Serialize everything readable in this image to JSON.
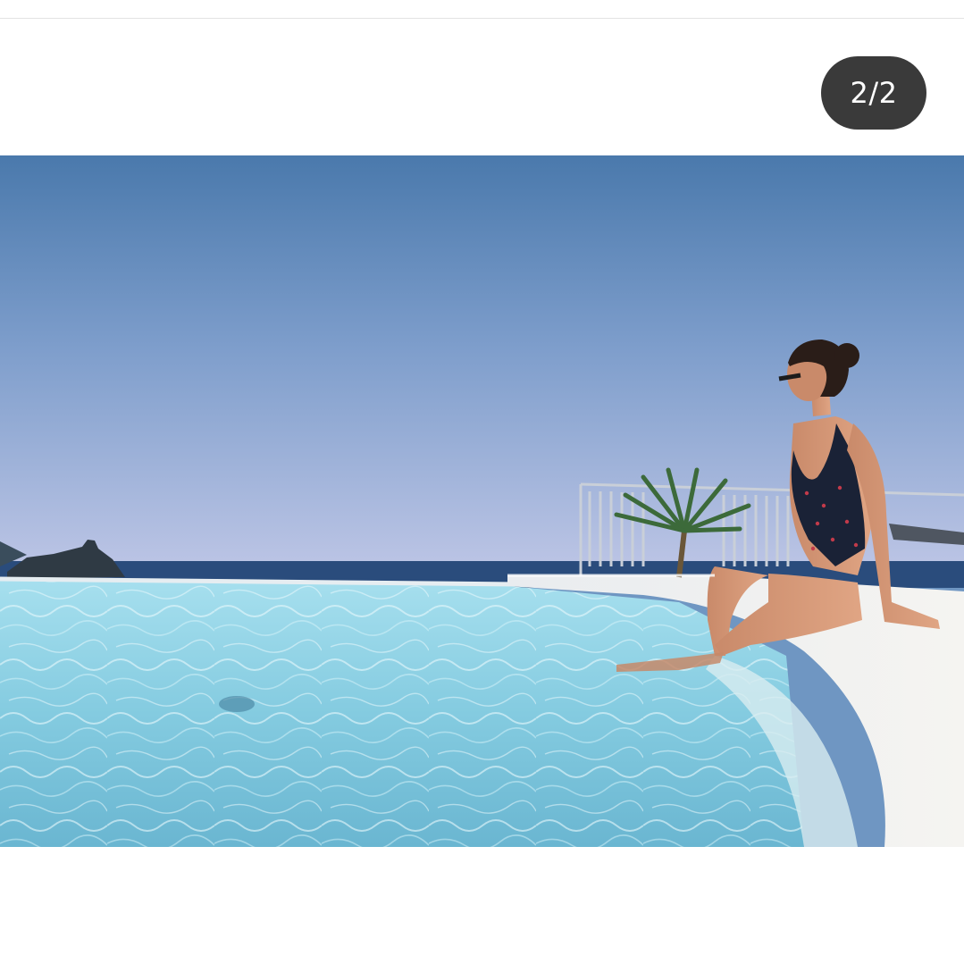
{
  "viewer": {
    "page_counter": "2/2"
  },
  "photo": {
    "subject": "woman-sitting-on-pool-edge",
    "scene": "infinity-pool-overlooking-sea",
    "colors": {
      "sky_top": "#4a79ac",
      "sky_horizon": "#b9c3e3",
      "sea": "#2a4c7c",
      "pool_water": "#8fd3e6",
      "pool_edge": "#f2f1ee",
      "swimsuit": "#1a2236"
    }
  }
}
